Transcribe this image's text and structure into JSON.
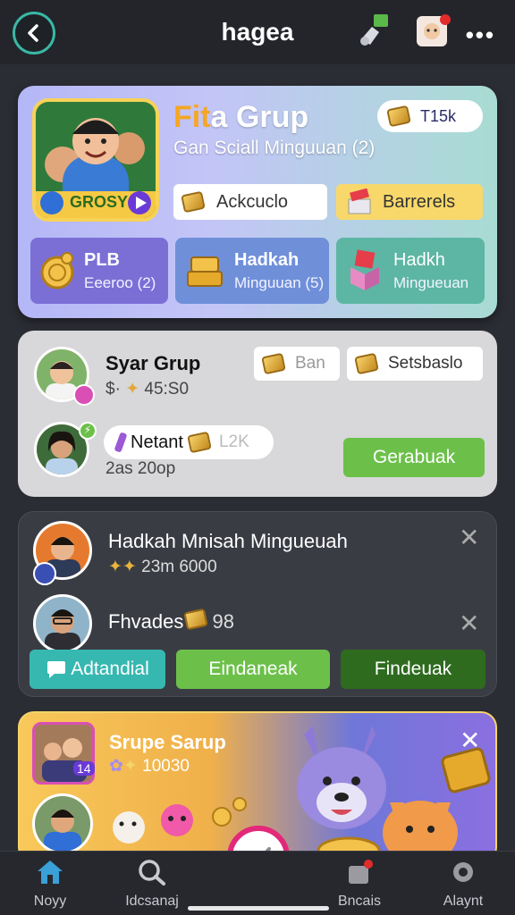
{
  "topbar": {
    "title": "hagea"
  },
  "group_card": {
    "title_a": "Fit",
    "title_b": "a Grup",
    "subtitle": "Gan Sciall Minguuan (2)",
    "avatar_label": "GROSY",
    "coin_value": "T15k",
    "btn_left": "Ackcuclo",
    "btn_right": "Barrerels",
    "tiles": [
      {
        "title": "PLB",
        "sub": "Eeeroo (2)"
      },
      {
        "title": "Hadkah",
        "sub": "Minguuan (5)"
      },
      {
        "title": "Hadkh",
        "sub": "Mingueuan"
      }
    ]
  },
  "syar_card": {
    "name": "Syar Grup",
    "sub_prefix": "$·",
    "sub_value": "45:S0",
    "pill1": "Ban",
    "pill2": "Setsbaslo",
    "member_name": "Netant",
    "member_coins": "L2K",
    "member_sub": "2as 20op",
    "action": "Gerabuak"
  },
  "list_card": {
    "row1_name": "Hadkah Mnisah Mingueuah",
    "row1_sub": "23m 6000",
    "row2_name": "Fhvades",
    "row2_value": "98",
    "buttons": [
      "Adtandial",
      "Eindaneak",
      "Findeuak"
    ]
  },
  "promo_card": {
    "name": "Srupe Sarup",
    "sub": "10030",
    "badge": "14"
  },
  "nav": {
    "items": [
      {
        "label": "Noyy",
        "icon": "home-icon"
      },
      {
        "label": "Idcsanaj",
        "icon": "search-icon"
      },
      {
        "label": "Bncais",
        "icon": "inbox-icon"
      },
      {
        "label": "Alaynt",
        "icon": "gear-icon"
      }
    ]
  },
  "colors": {
    "accent": "#39b8a6",
    "fab": "#e3287a",
    "green": "#6cc04a",
    "dark_green": "#2e6b1f"
  }
}
